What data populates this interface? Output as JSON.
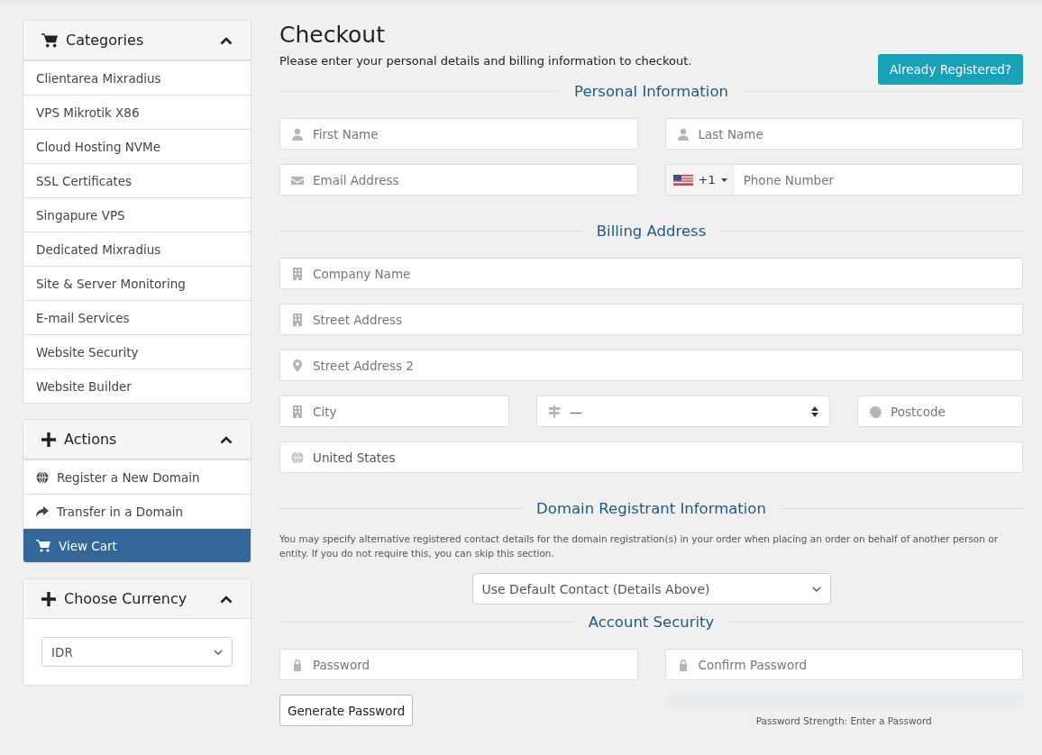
{
  "sidebar": {
    "panels": [
      {
        "title": "Categories",
        "items": [
          {
            "label": "Clientarea Mixradius",
            "selected": false
          },
          {
            "label": "VPS Mikrotik X86",
            "selected": false
          },
          {
            "label": "Cloud Hosting NVMe",
            "selected": false
          },
          {
            "label": "SSL Certificates",
            "selected": false
          },
          {
            "label": "Singapure VPS",
            "selected": false
          },
          {
            "label": "Dedicated Mixradius",
            "selected": false
          },
          {
            "label": "Site & Server Monitoring",
            "selected": false
          },
          {
            "label": "E-mail Services",
            "selected": false
          },
          {
            "label": "Website Security",
            "selected": false
          },
          {
            "label": "Website Builder",
            "selected": false
          }
        ]
      },
      {
        "title": "Actions",
        "items": [
          {
            "label": "Register a New Domain",
            "selected": false
          },
          {
            "label": "Transfer in a Domain",
            "selected": false
          },
          {
            "label": "View Cart",
            "selected": true
          }
        ]
      },
      {
        "title": "Choose Currency",
        "select": {
          "value": "IDR"
        }
      }
    ]
  },
  "main": {
    "title": "Checkout",
    "intro": "Please enter your personal details and billing information to checkout.",
    "already_registered_button": "Already Registered?",
    "sections": [
      {
        "heading": "Personal Information",
        "rows": [
          [
            {
              "kind": "text",
              "placeholder": "First Name"
            },
            {
              "kind": "text",
              "placeholder": "Last Name"
            }
          ],
          [
            {
              "kind": "text",
              "placeholder": "Email Address"
            },
            {
              "kind": "phone",
              "dial_code": "+1",
              "placeholder": "Phone Number"
            }
          ]
        ]
      },
      {
        "heading": "Billing Address",
        "rows": [
          [
            {
              "kind": "text",
              "placeholder": "Company Name"
            }
          ],
          [
            {
              "kind": "text",
              "placeholder": "Street Address"
            }
          ],
          [
            {
              "kind": "text",
              "placeholder": "Street Address 2"
            }
          ],
          [
            {
              "kind": "text",
              "placeholder": "City"
            },
            {
              "kind": "select",
              "value": "—"
            },
            {
              "kind": "text",
              "placeholder": "Postcode"
            }
          ],
          [
            {
              "kind": "text",
              "value": "United States"
            }
          ]
        ]
      },
      {
        "heading": "Domain Registrant Information",
        "note": "You may specify alternative registered contact details for the domain registration(s) in your order when placing an order on behalf of another person or entity. If you do not require this, you can skip this section.",
        "select": {
          "value": "Use Default Contact (Details Above)"
        }
      },
      {
        "heading": "Account Security",
        "rows": [
          [
            {
              "kind": "text",
              "placeholder": "Password"
            },
            {
              "kind": "text",
              "placeholder": "Confirm Password"
            }
          ]
        ],
        "generate_button": "Generate Password",
        "strength": {
          "level": 0,
          "text": "Password Strength: Enter a Password"
        }
      }
    ]
  }
}
